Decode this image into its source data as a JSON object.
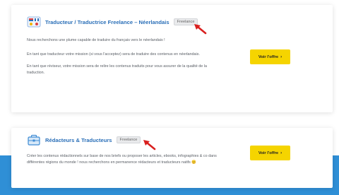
{
  "jobs": [
    {
      "title": "Traducteur / Traductrice Freelance – Néerlandais",
      "badge": "Freelance",
      "icon": "translation-flags-icon",
      "description": [
        "Nous recherchons une plume capable de traduire du français vers le néerlandais !",
        "En tant que traducteur votre mission (si vous l'acceptez) sera de traduire des contenus en néerlandais.",
        "En tant que réviseur, votre mission sera de relire les contenus traduits pour vous assurer de la qualité de la traduction."
      ],
      "button": "Voir l'offre"
    },
    {
      "title": "Rédacteurs & Traducteurs",
      "badge": "Freelance",
      "icon": "briefcase-icon",
      "description": [
        "Créer les contenus rédactionnels sur base de nos briefs ou proposer les articles, ebooks, infographies & co dans différentes régions du monde ! nous recherchons en permanence rédacteurs et traducteurs natifs 😊"
      ],
      "button": "Voir l'offre"
    }
  ],
  "colors": {
    "title": "#2a6fb8",
    "button_bg": "#f5d400",
    "band": "#2f8fd6",
    "arrow": "#d9201f"
  }
}
